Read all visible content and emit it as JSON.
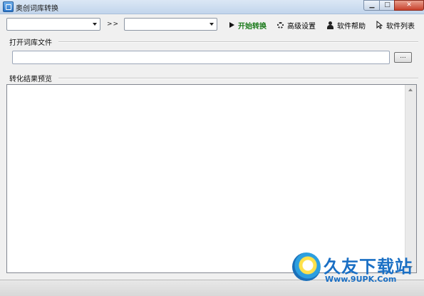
{
  "window": {
    "title": "奥创词库转换"
  },
  "toolbar": {
    "source_combo_value": "",
    "target_combo_value": "",
    "arrows": ">>",
    "start_label": "开始转换",
    "advanced_label": "高级设置",
    "help_label": "软件帮助",
    "list_label": "软件列表"
  },
  "open_section": {
    "label": "打开词库文件",
    "file_path_value": "",
    "browse_label": "..."
  },
  "preview_section": {
    "label": "转化结果预览",
    "content": ""
  },
  "watermark": {
    "title": "久友下载站",
    "url": "Www.9UPK.Com"
  },
  "colors": {
    "start_green": "#1a7a1a",
    "watermark_blue": "#1a6fc4"
  }
}
